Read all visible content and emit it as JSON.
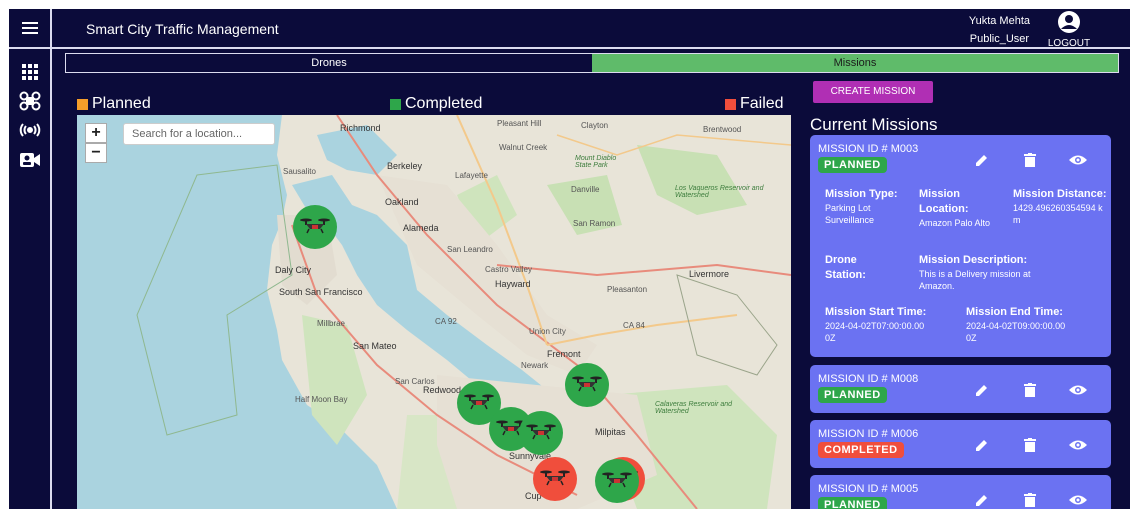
{
  "app": {
    "title": "Smart City Traffic Management",
    "user_name": "Yukta Mehta",
    "user_role": "Public_User",
    "logout_label": "LOGOUT"
  },
  "sidebar": {
    "items": [
      {
        "name": "dashboard-grid-icon"
      },
      {
        "name": "drone-icon"
      },
      {
        "name": "broadcast-icon"
      },
      {
        "name": "camera-icon"
      }
    ]
  },
  "tabs": [
    {
      "label": "Drones",
      "active": false
    },
    {
      "label": "Missions",
      "active": true
    }
  ],
  "legend": [
    {
      "label": "Planned",
      "color": "#f59e2a"
    },
    {
      "label": "Completed",
      "color": "#2ea64a"
    },
    {
      "label": "Failed",
      "color": "#f04e3c"
    }
  ],
  "map": {
    "search_placeholder": "Search for a location...",
    "zoom_in": "+",
    "zoom_out": "−",
    "labels": {
      "richmond": "Richmond",
      "berkeley": "Berkeley",
      "oakland": "Oakland",
      "alameda": "Alameda",
      "san_leandro": "San Leandro",
      "castro_valley": "Castro Valley",
      "hayward": "Hayward",
      "livermore": "Livermore",
      "pleasanton": "Pleasanton",
      "daly_city": "Daly City",
      "south_sf": "South San Francisco",
      "millbrae": "Millbrae",
      "san_mateo": "San Mateo",
      "san_carlos": "San Carlos",
      "redwood_city": "Redwood City",
      "fremont": "Fremont",
      "newark": "Newark",
      "union_city": "Union City",
      "milpitas": "Milpitas",
      "sunnyvale": "Sunnyvale",
      "half_moon_bay": "Half Moon Bay",
      "clayton": "Clayton",
      "walnut_creek": "Walnut Creek",
      "lafayette": "Lafayette",
      "danville": "Danville",
      "san_ramon": "San Ramon",
      "brentwood": "Brentwood",
      "sausalito": "Sausalito",
      "pleasant_hill": "Pleasant Hill",
      "ca92": "CA 92",
      "ca84": "CA 84",
      "los_vaqueros": "Los Vaqueros Reservoir and Watershed",
      "mount_diablo": "Mount Diablo State Park",
      "calaveras": "Calaveras Reservoir and Watershed",
      "cupertino": "Cup"
    }
  },
  "create_mission_label": "CREATE MISSION",
  "missions_heading": "Current Missions",
  "missions": [
    {
      "id_label": "MISSION ID # M003",
      "status": "PLANNED",
      "type_key": "Mission Type:",
      "type_val": "Parking Lot Surveillance",
      "location_key": "Mission Location:",
      "location_val": "Amazon Palo Alto",
      "distance_key": "Mission Distance:",
      "distance_val": "1429.496260354594 km",
      "station_key": "Drone Station:",
      "description_key": "Mission Description:",
      "description_val": "This is a Delivery mission at Amazon.",
      "start_key": "Mission Start Time:",
      "start_val": "2024-04-02T07:00:00.000Z",
      "end_key": "Mission End Time:",
      "end_val": "2024-04-02T09:00:00.000Z"
    },
    {
      "id_label": "MISSION ID # M008",
      "status": "PLANNED"
    },
    {
      "id_label": "MISSION ID # M006",
      "status": "COMPLETED"
    },
    {
      "id_label": "MISSION ID # M005",
      "status": "PLANNED"
    }
  ]
}
